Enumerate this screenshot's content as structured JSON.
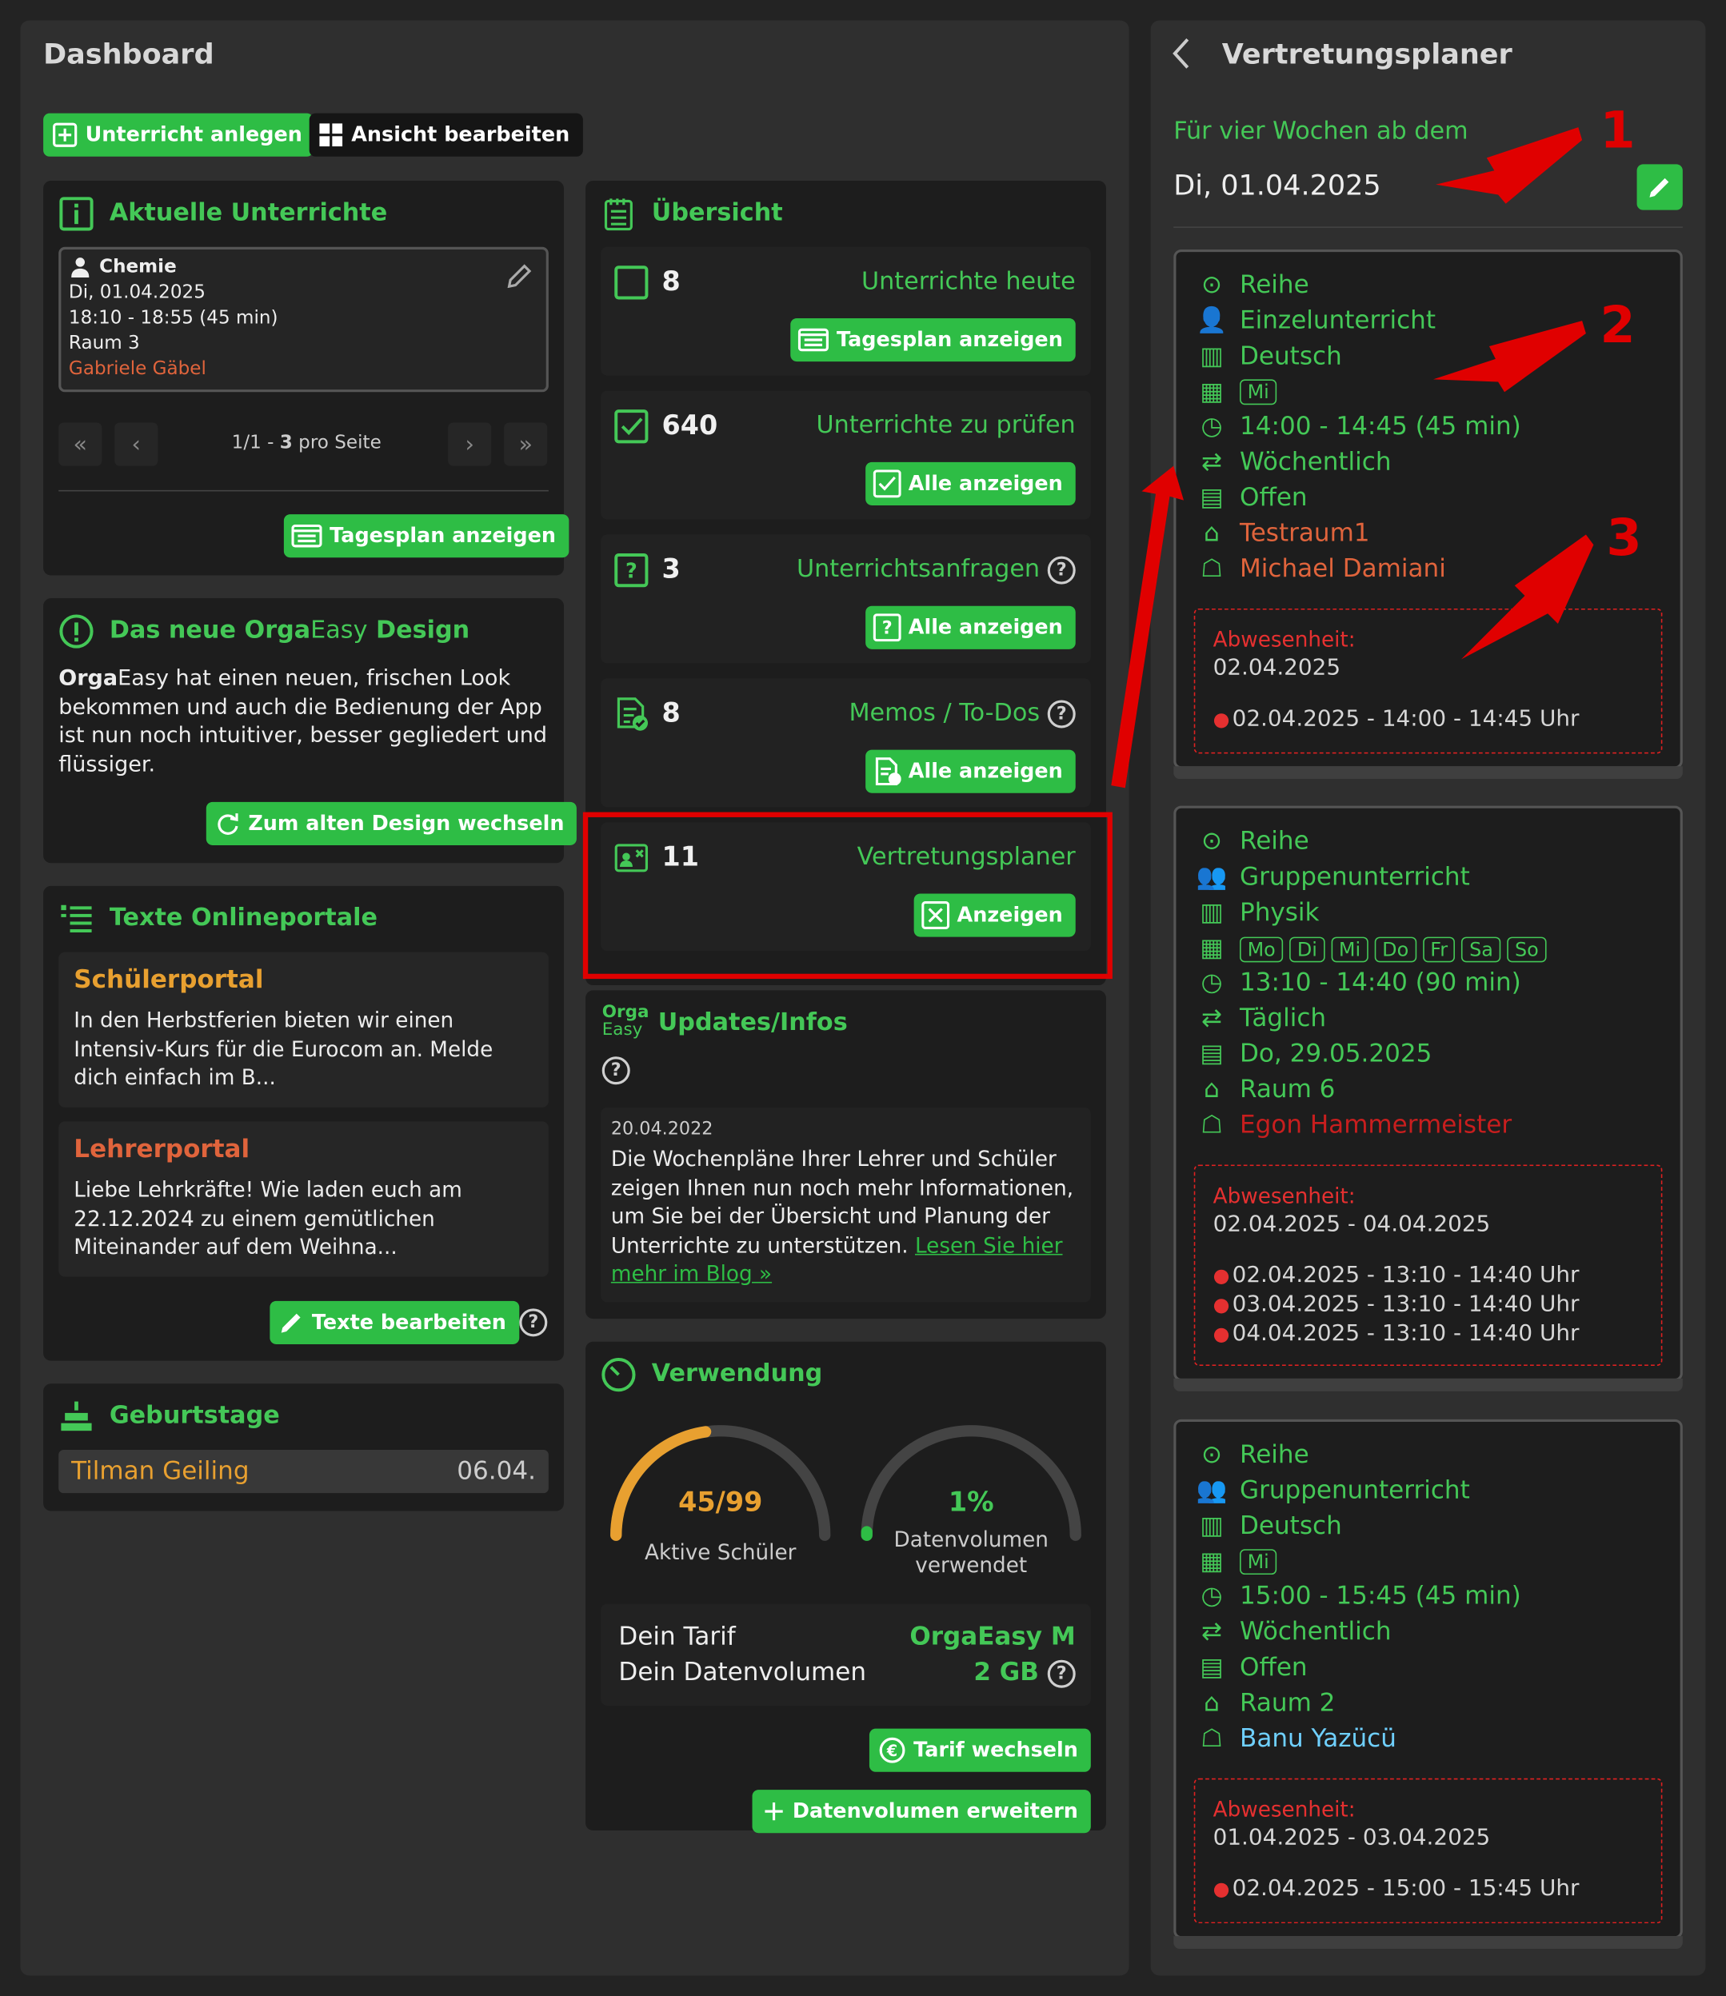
{
  "dashboard": {
    "title": "Dashboard",
    "add_lesson": "Unterricht anlegen",
    "edit_view": "Ansicht bearbeiten"
  },
  "current": {
    "title": "Aktuelle Unterrichte",
    "subject": "Chemie",
    "date": "Di, 01.04.2025",
    "time": "18:10 - 18:55 (45 min)",
    "room": "Raum 3",
    "teacher": "Gabriele Gäbel",
    "page": "1/1 -",
    "per_page_num": "3",
    "per_page": "pro Seite",
    "dayplan": "Tagesplan anzeigen"
  },
  "design": {
    "title_a": "Das neue ",
    "title_b": "Orga",
    "title_c": "Easy",
    "title_d": " Design",
    "text_a": "Orga",
    "text_b": "Easy hat einen neuen, frischen Look bekommen und auch die Bedienung der App ist nun noch intuitiver, besser gegliedert und flüssiger.",
    "switch": "Zum alten Design wechseln"
  },
  "portals": {
    "title": "Texte Onlineportale",
    "student_title": "Schülerportal",
    "student_text": "In den Herbstferien bieten wir einen Intensiv-Kurs für die Eurocom an. Melde dich einfach im B...",
    "teacher_title": "Lehrerportal",
    "teacher_text": "Liebe Lehrkräfte! Wie laden euch am 22.12.2024 zu einem gemütlichen Miteinander auf dem Weihna...",
    "edit": "Texte bearbeiten"
  },
  "birthdays": {
    "title": "Geburtstage",
    "name": "Tilman Geiling",
    "date": "06.04."
  },
  "overview": {
    "title": "Übersicht",
    "items": [
      {
        "count": "8",
        "label": "Unterrichte heute",
        "button": "Tagesplan anzeigen"
      },
      {
        "count": "640",
        "label": "Unterrichte zu prüfen",
        "button": "Alle anzeigen"
      },
      {
        "count": "3",
        "label": "Unterrichtsanfragen",
        "button": "Alle anzeigen"
      },
      {
        "count": "8",
        "label": "Memos / To-Dos",
        "button": "Alle anzeigen"
      },
      {
        "count": "11",
        "label": "Vertretungsplaner",
        "button": "Anzeigen"
      }
    ]
  },
  "updates": {
    "logo_a": "Orga",
    "logo_b": "Easy",
    "title": "Updates/Infos",
    "date": "20.04.2022",
    "text": "Die Wochenpläne Ihrer Lehrer und Schüler zeigen Ihnen nun noch mehr Informationen, um Sie bei der Übersicht und Planung der Unterrichte zu unterstützen. ",
    "link": "Lesen Sie hier mehr im Blog »"
  },
  "usage": {
    "title": "Verwendung",
    "students_value": "45/99",
    "students_label": "Aktive Schüler",
    "students_fraction": 0.4545,
    "data_value": "1%",
    "data_label_1": "Datenvolumen",
    "data_label_2": "verwendet",
    "data_fraction": 0.01,
    "tariff_label": "Dein Tarif",
    "tariff_value": "OrgaEasy M",
    "volume_label": "Dein Datenvolumen",
    "volume_value": "2 GB",
    "change_tariff": "Tarif wechseln",
    "expand": "Datenvolumen erweitern"
  },
  "planner": {
    "title": "Vertretungsplaner",
    "period_label": "Für vier Wochen ab dem",
    "period_date": "Di, 01.04.2025",
    "entries": [
      {
        "series": "Reihe",
        "type": "Einzelunterricht",
        "subject": "Deutsch",
        "days": [
          "Mi"
        ],
        "time": "14:00 - 14:45  (45 min)",
        "freq": "Wöchentlich",
        "end": "Offen",
        "room": "Testraum1",
        "teacher": "Michael Damiani",
        "abs_title": "Abwesenheit:",
        "abs_range": "02.04.2025",
        "abs_items": [
          "02.04.2025 - 14:00 - 14:45 Uhr"
        ]
      },
      {
        "series": "Reihe",
        "type": "Gruppenunterricht",
        "subject": "Physik",
        "days": [
          "Mo",
          "Di",
          "Mi",
          "Do",
          "Fr",
          "Sa",
          "So"
        ],
        "time": "13:10 - 14:40  (90 min)",
        "freq": "Täglich",
        "end": "Do, 29.05.2025",
        "room": "Raum 6",
        "teacher": "Egon Hammermeister",
        "abs_title": "Abwesenheit:",
        "abs_range": "02.04.2025 - 04.04.2025",
        "abs_items": [
          "02.04.2025 - 13:10 - 14:40 Uhr",
          "03.04.2025 - 13:10 - 14:40 Uhr",
          "04.04.2025 - 13:10 - 14:40 Uhr"
        ]
      },
      {
        "series": "Reihe",
        "type": "Gruppenunterricht",
        "subject": "Deutsch",
        "days": [
          "Mi"
        ],
        "time": "15:00 - 15:45  (45 min)",
        "freq": "Wöchentlich",
        "end": "Offen",
        "room": "Raum 2",
        "teacher": "Banu Yazücü",
        "abs_title": "Abwesenheit:",
        "abs_range": "01.04.2025 - 03.04.2025",
        "abs_items": [
          "02.04.2025 - 15:00 - 15:45 Uhr"
        ]
      }
    ]
  },
  "annotations": {
    "n1": "1",
    "n2": "2",
    "n3": "3"
  },
  "colors": {
    "accent": "#2ebd45",
    "text_green": "#44c857",
    "warning": "#e8a030",
    "danger": "#e02020",
    "link_blue": "#6fd0ff"
  }
}
